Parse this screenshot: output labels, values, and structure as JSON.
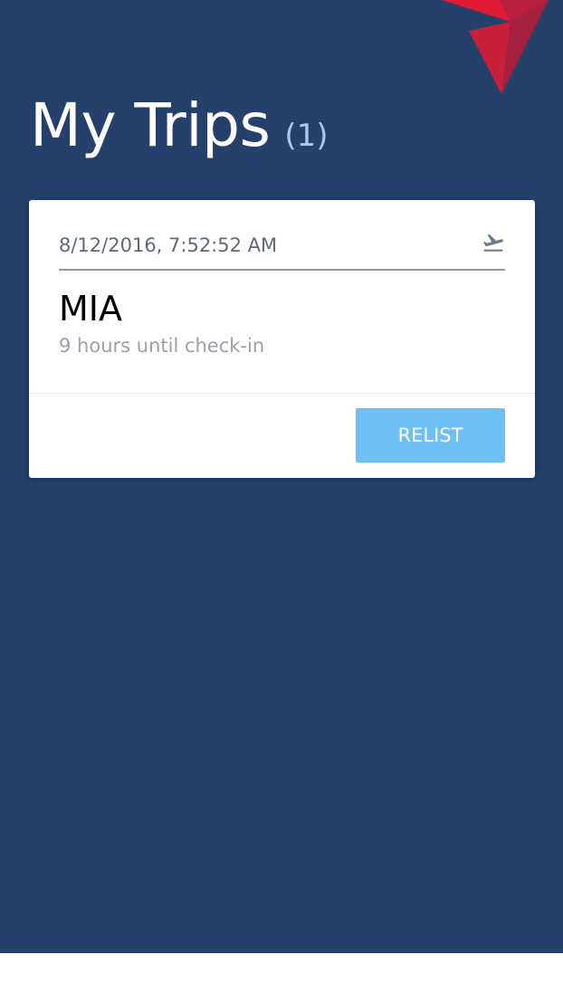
{
  "header": {
    "title": "My Trips",
    "count": "(1)",
    "logo_icon": "delta-logo-icon"
  },
  "trips": [
    {
      "datetime": "8/12/2016, 7:52:52 AM",
      "status_icon": "airplane-takeoff-icon",
      "destination": "MIA",
      "checkin_status": "9 hours until check-in",
      "action_label": "RELIST"
    }
  ],
  "colors": {
    "background": "#24406b",
    "logo_red": "#e11937",
    "count_text": "#a9c8ee",
    "button": "#6ebff5",
    "card": "#ffffff",
    "muted_text": "#9aa1a8"
  }
}
